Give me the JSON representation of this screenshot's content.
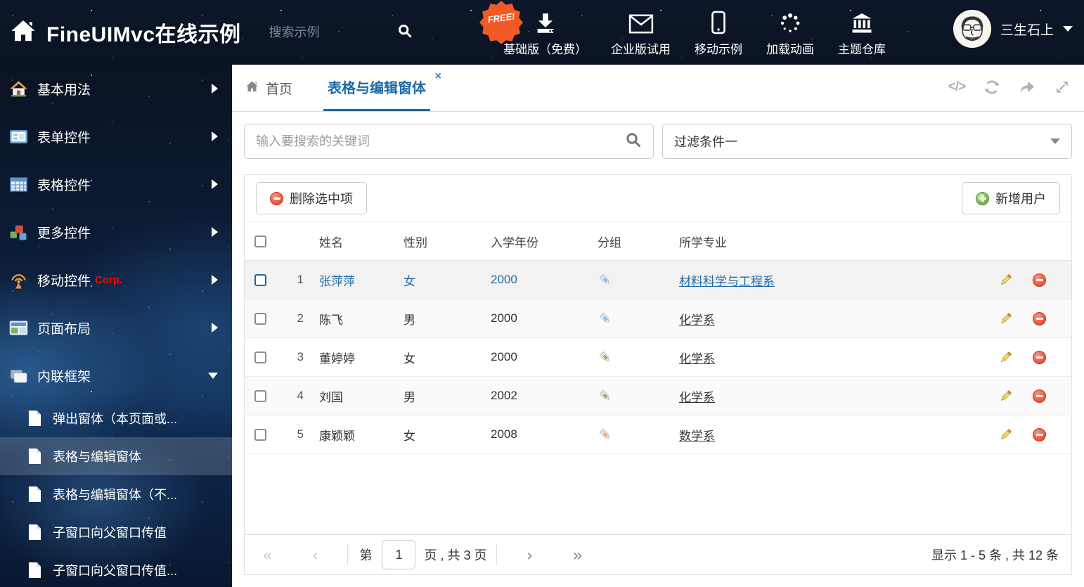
{
  "header": {
    "title": "FineUIMvc在线示例",
    "search_placeholder": "搜索示例",
    "free_badge": "FREE!",
    "nav": [
      {
        "label": "基础版（免费）",
        "icon": "download-icon"
      },
      {
        "label": "企业版试用",
        "icon": "envelope-icon"
      },
      {
        "label": "移动示例",
        "icon": "mobile-icon"
      },
      {
        "label": "加载动画",
        "icon": "spinner-icon"
      },
      {
        "label": "主题仓库",
        "icon": "bank-icon"
      }
    ],
    "user_name": "三生石上"
  },
  "sidebar": {
    "items": [
      {
        "label": "基本用法",
        "icon": "house-icon"
      },
      {
        "label": "表单控件",
        "icon": "form-icon"
      },
      {
        "label": "表格控件",
        "icon": "grid-icon"
      },
      {
        "label": "更多控件",
        "icon": "cubes-icon"
      },
      {
        "label": "移动控件",
        "badge": "Corp.",
        "icon": "antenna-icon"
      },
      {
        "label": "页面布局",
        "icon": "layout-icon"
      },
      {
        "label": "内联框架",
        "icon": "frames-icon"
      }
    ],
    "submenu": [
      {
        "label": "弹出窗体（本页面或..."
      },
      {
        "label": "表格与编辑窗体"
      },
      {
        "label": "表格与编辑窗体（不..."
      },
      {
        "label": "子窗口向父窗口传值"
      },
      {
        "label": "子窗口向父窗口传值..."
      }
    ]
  },
  "tabs": {
    "home_label": "首页",
    "active_label": "表格与编辑窗体",
    "close_label": "×",
    "code_tool_label": "</>"
  },
  "content": {
    "search_placeholder": "输入要搜索的关键词",
    "filter_value": "过滤条件一",
    "delete_button": "删除选中项",
    "add_button": "新增用户"
  },
  "table": {
    "headers": {
      "name": "姓名",
      "gender": "性别",
      "year": "入学年份",
      "group": "分组",
      "major": "所学专业"
    },
    "rows": [
      {
        "num": "1",
        "name": "张萍萍",
        "gender": "女",
        "year": "2000",
        "tag": "blue",
        "major": "材料科学与工程系"
      },
      {
        "num": "2",
        "name": "陈飞",
        "gender": "男",
        "year": "2000",
        "tag": "blue",
        "major": "化学系"
      },
      {
        "num": "3",
        "name": "董婷婷",
        "gender": "女",
        "year": "2000",
        "tag": "green",
        "major": "化学系"
      },
      {
        "num": "4",
        "name": "刘国",
        "gender": "男",
        "year": "2002",
        "tag": "green",
        "major": "化学系"
      },
      {
        "num": "5",
        "name": "康颖颖",
        "gender": "女",
        "year": "2008",
        "tag": "orange",
        "major": "数学系"
      }
    ]
  },
  "pagination": {
    "first": "«",
    "prev": "‹",
    "page_prefix": "第",
    "page_value": "1",
    "page_suffix": "页 , 共 3 页",
    "next": "›",
    "last": "»",
    "summary": "显示 1 - 5 条 , 共 12 条"
  },
  "colors": {
    "accent": "#1e6aa7",
    "danger": "#e8503a",
    "success": "#5cb85c",
    "free_badge": "#f15a24",
    "tag_blue": "#7ec2f0",
    "tag_green": "#84b860",
    "tag_orange": "#f6a963"
  }
}
